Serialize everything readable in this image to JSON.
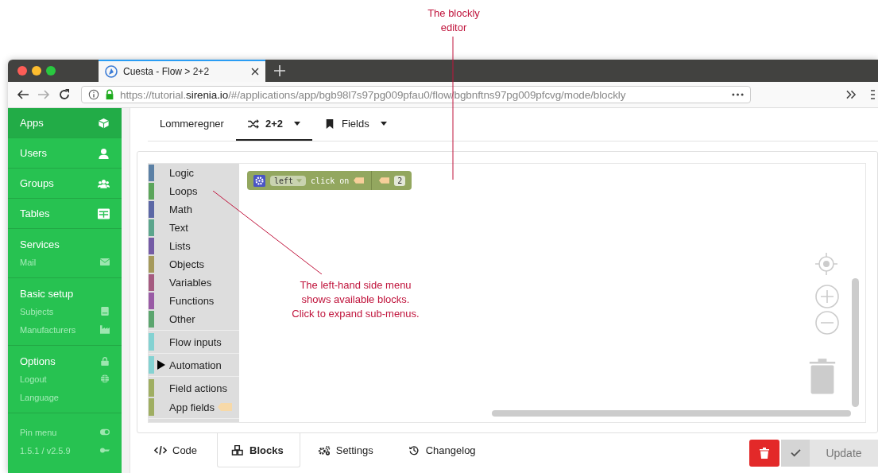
{
  "annotations": [
    {
      "text": "The blockly\neditor"
    },
    {
      "text": "The left-hand side menu\nshows available blocks.\nClick to expand sub-menus."
    }
  ],
  "browser": {
    "tab_title": "Cuesta - Flow > 2+2",
    "url": "https://tutorial.**sirenia.io**/#/applications/app/bgb98l7s97pg009pfau0/flow/bgbnftns97pg009pfcvg/mode/blockly"
  },
  "sidebar": {
    "items": [
      {
        "kind": "main",
        "label": "Apps",
        "selected": true
      },
      {
        "kind": "main",
        "label": "Users",
        "selected": false
      },
      {
        "kind": "main",
        "label": "Groups",
        "selected": false
      },
      {
        "kind": "main",
        "label": "Tables",
        "selected": false
      },
      {
        "kind": "heading",
        "label": "Services"
      },
      {
        "kind": "sub",
        "label": "Mail"
      },
      {
        "kind": "heading",
        "label": "Basic setup"
      },
      {
        "kind": "sub",
        "label": "Subjects"
      },
      {
        "kind": "sub",
        "label": "Manufacturers"
      },
      {
        "kind": "heading",
        "label": "Options"
      },
      {
        "kind": "sub",
        "label": "Logout"
      },
      {
        "kind": "sub",
        "label": "Language"
      },
      {
        "kind": "footer",
        "label": "Pin menu"
      },
      {
        "kind": "footer",
        "label": "1.5.1 / v2.5.9"
      }
    ]
  },
  "top_tabs": [
    {
      "label": "Lommeregner",
      "selected": false
    },
    {
      "label": "2+2",
      "selected": true
    },
    {
      "label": "Fields",
      "selected": false
    }
  ],
  "toolbox": {
    "sections": [
      {
        "categories": [
          {
            "label": "Logic",
            "color": "#5b80a5"
          },
          {
            "label": "Loops",
            "color": "#5ba55b"
          },
          {
            "label": "Math",
            "color": "#5b67a5"
          },
          {
            "label": "Text",
            "color": "#5ba58c"
          },
          {
            "label": "Lists",
            "color": "#745ba5"
          },
          {
            "label": "Objects",
            "color": "#a5995b"
          },
          {
            "label": "Variables",
            "color": "#a55b80"
          },
          {
            "label": "Functions",
            "color": "#995ba5"
          },
          {
            "label": "Other",
            "color": "#5ba56e"
          }
        ]
      },
      {
        "categories": [
          {
            "label": "Flow inputs",
            "color": "#84d2d2"
          }
        ]
      },
      {
        "categories": [
          {
            "label": "Automation",
            "color": "#84d2d2",
            "expanded": false
          }
        ]
      },
      {
        "categories": [
          {
            "label": "Field actions",
            "color": "#9fae62"
          },
          {
            "label": "App fields",
            "color": "#9fae62"
          }
        ]
      }
    ]
  },
  "block": {
    "dropdown": "left",
    "text": "click on",
    "value": "2"
  },
  "bottom_tabs": [
    {
      "label": "Code",
      "selected": false
    },
    {
      "label": "Blocks",
      "selected": true
    },
    {
      "label": "Settings",
      "selected": false
    },
    {
      "label": "Changelog",
      "selected": false
    }
  ],
  "update_button": {
    "label": "Update",
    "disabled": true
  }
}
